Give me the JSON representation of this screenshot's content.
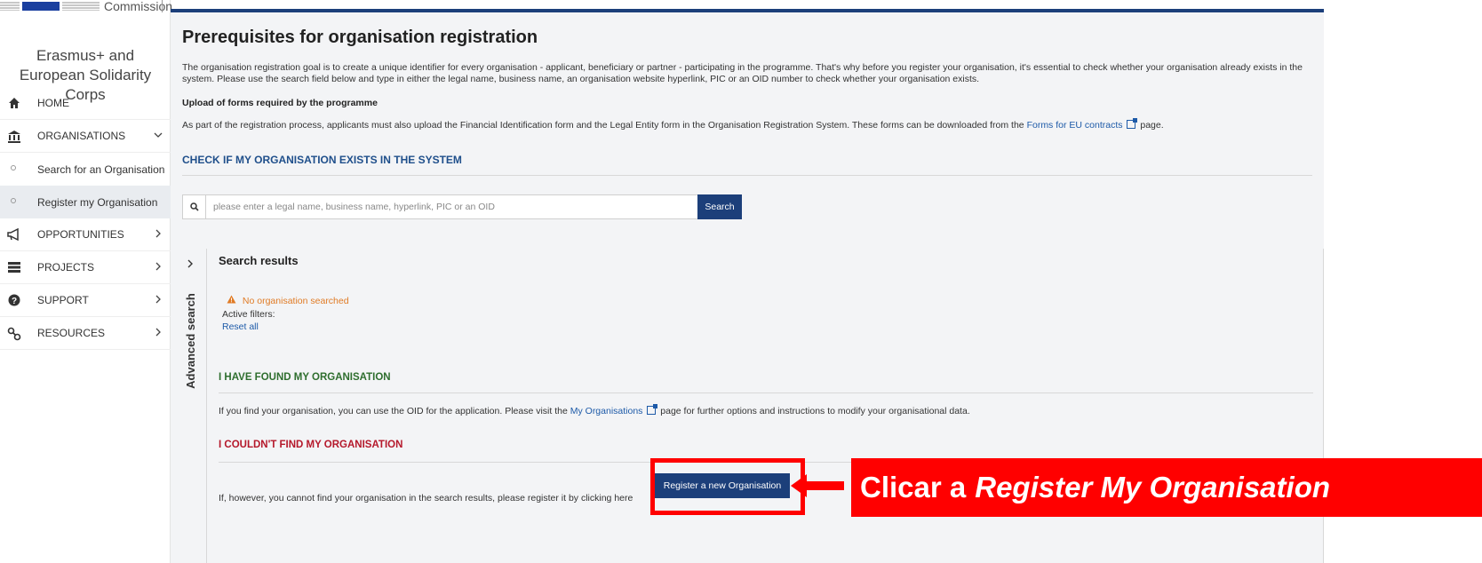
{
  "header": {
    "commission_label": "Commission"
  },
  "sidebar": {
    "app_title": "Erasmus+ and European Solidarity Corps",
    "items": [
      {
        "label": "HOME",
        "icon": "home-icon"
      },
      {
        "label": "ORGANISATIONS",
        "icon": "institution-icon",
        "expanded": true
      },
      {
        "label": "Search for an Organisation",
        "sub": true
      },
      {
        "label": "Register my Organisation",
        "sub": true,
        "active": true
      },
      {
        "label": "OPPORTUNITIES",
        "icon": "megaphone-icon"
      },
      {
        "label": "PROJECTS",
        "icon": "server-icon"
      },
      {
        "label": "SUPPORT",
        "icon": "question-circle-icon"
      },
      {
        "label": "RESOURCES",
        "icon": "link-icon"
      }
    ]
  },
  "main": {
    "title": "Prerequisites for organisation registration",
    "intro": "The organisation registration goal is to create a unique identifier for every organisation - applicant, beneficiary or partner - participating in the programme. That's why before you register your organisation, it's essential to check whether your organisation already exists in the system. Please use the search field below and type in either the legal name, business name, an organisation website hyperlink, PIC or an OID number to check whether your organisation exists.",
    "upload_heading": "Upload of forms required by the programme",
    "upload_text": "As part of the registration process, applicants must also upload the Financial Identification form and the Legal Entity form in the Organisation Registration System. These forms can be downloaded from the",
    "upload_link": "Forms for EU contracts",
    "upload_suffix": "page.",
    "check_heading": "CHECK IF MY ORGANISATION EXISTS IN THE SYSTEM",
    "search": {
      "placeholder": "please enter a legal name, business name, hyperlink, PIC or an OID",
      "button": "Search"
    },
    "advanced_search": "Advanced search",
    "results": {
      "title": "Search results",
      "warning": "No organisation searched",
      "active_filters": "Active filters:",
      "reset_all": "Reset all"
    },
    "found": {
      "heading": "I HAVE FOUND MY ORGANISATION",
      "text_before": "If you find your organisation, you can use the OID for the application. Please visit the",
      "link": "My Organisations",
      "text_after": "page for further options and instructions to modify your organisational data."
    },
    "not_found": {
      "heading": "I COULDN'T FIND MY ORGANISATION",
      "text": "If, however, you cannot find your organisation in the search results, please register it by clicking here",
      "button": "Register a new Organisation"
    }
  },
  "annotation": {
    "callout_prefix": "Clicar a",
    "callout_emphasis": "Register My Organisation",
    "color": "#ff0000"
  }
}
